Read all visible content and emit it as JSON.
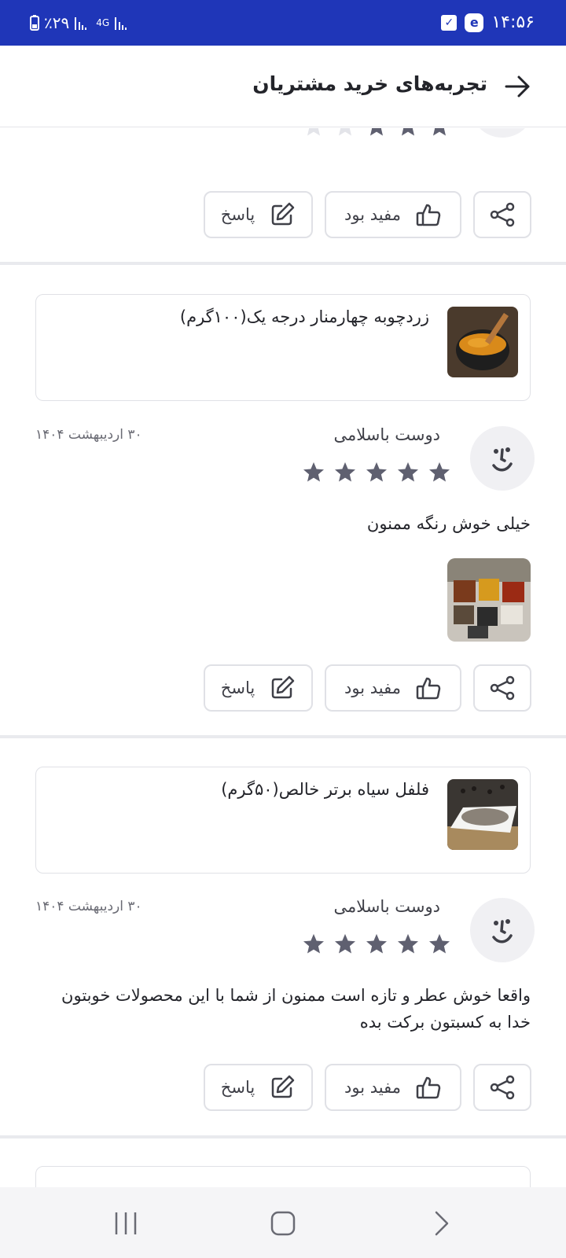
{
  "status_bar": {
    "time": "۱۴:۵۶",
    "battery": "٪۲۹",
    "network": "4G",
    "bg_color": "#1f36b8"
  },
  "header": {
    "title": "تجربه‌های خرید مشتریان",
    "back_icon": "arrow-right-icon"
  },
  "actions": {
    "reply_label": "پاسخ",
    "helpful_label": "مفید بود",
    "share_icon": "share-icon"
  },
  "top_partial_review": {
    "rating": 3
  },
  "reviews": [
    {
      "product_title": "زردچوبه چهارمنار درجه یک(۱۰۰گرم)",
      "user_name": "دوست باسلامی",
      "date": "۳۰ اردیبهشت ۱۴۰۴",
      "rating": 5,
      "text": "خیلی خوش رنگه ممنون",
      "has_photo": true
    },
    {
      "product_title": "فلفل سیاه برتر خالص(۵۰گرم)",
      "user_name": "دوست باسلامی",
      "date": "۳۰ اردیبهشت ۱۴۰۴",
      "rating": 5,
      "text": "واقعا خوش عطر و تازه است ممنون از شما با این محصولات خوبتون خدا به کسبتون برکت بده",
      "has_photo": false
    }
  ],
  "colors": {
    "accent": "#1f36b8",
    "star": "#5f6070",
    "star_empty": "#e3e4e9",
    "border": "#e0e1e6"
  }
}
